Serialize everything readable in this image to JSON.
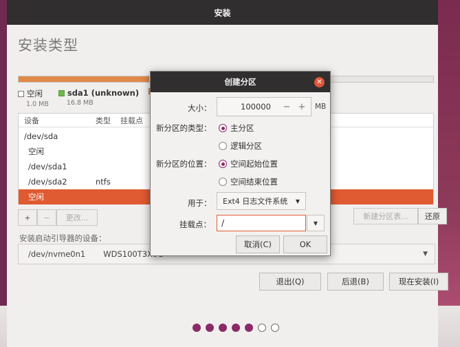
{
  "window": {
    "title": "安装"
  },
  "page_title": "安装类型",
  "legend": [
    {
      "label": "空闲",
      "size": "1.0 MB",
      "color": "#ffffff"
    },
    {
      "label": "sda1 (unknown)",
      "size": "16.8 MB",
      "color": "#6fb84a"
    },
    {
      "label": "",
      "size": "",
      "color": "#e08a4a"
    }
  ],
  "table": {
    "headers": [
      "设备",
      "类型",
      "挂载点"
    ],
    "rows": [
      {
        "device": "/dev/sda",
        "type": ""
      },
      {
        "device": "空闲",
        "type": ""
      },
      {
        "device": "/dev/sda1",
        "type": ""
      },
      {
        "device": "/dev/sda2",
        "type": "ntfs"
      },
      {
        "device": "空闲",
        "type": "",
        "selected": true
      }
    ]
  },
  "table_buttons": {
    "add": "+",
    "remove": "−",
    "change": "更改..."
  },
  "new_partition_table": "新建分区表...",
  "revert": "还原",
  "boot_loader": {
    "label": "安装启动引导器的设备：",
    "device": "/dev/nvme0n1",
    "model": "WDS100T3X0C"
  },
  "nav": {
    "quit": "退出(Q)",
    "back": "后退(B)",
    "install_now": "现在安装(I)"
  },
  "dialog": {
    "title": "创建分区",
    "size_label": "大小：",
    "size_value": "100000",
    "minus": "−",
    "plus": "+",
    "unit": "MB",
    "type_label": "新分区的类型：",
    "type_primary": "主分区",
    "type_logical": "逻辑分区",
    "location_label": "新分区的位置：",
    "location_start": "空间起始位置",
    "location_end": "空间结束位置",
    "use_label": "用于：",
    "use_value": "Ext4 日志文件系统",
    "mount_label": "挂载点：",
    "mount_value": "/",
    "cancel": "取消(C)",
    "ok": "OK"
  },
  "progress_dots": {
    "filled": 5,
    "total": 7
  }
}
